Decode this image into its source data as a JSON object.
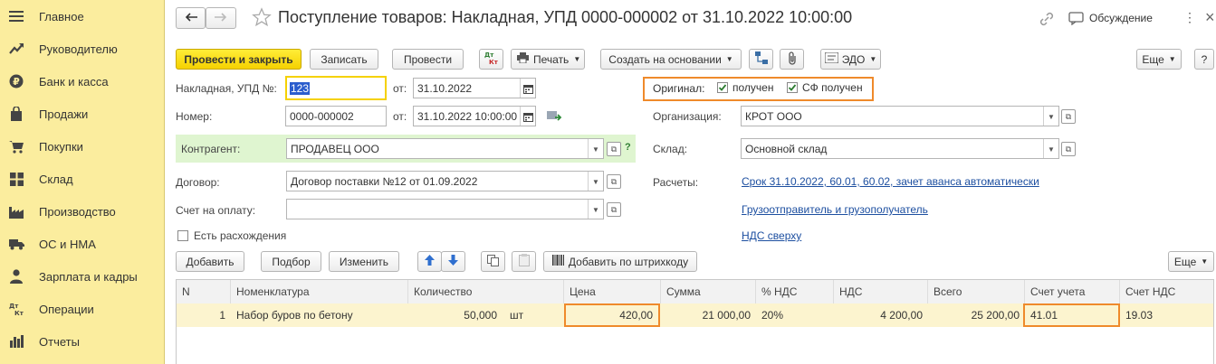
{
  "sidebar": {
    "items": [
      {
        "label": "Главное",
        "icon": "menu-icon"
      },
      {
        "label": "Руководителю",
        "icon": "trend-icon"
      },
      {
        "label": "Банк и касса",
        "icon": "ruble-icon"
      },
      {
        "label": "Продажи",
        "icon": "bag-icon"
      },
      {
        "label": "Покупки",
        "icon": "cart-icon"
      },
      {
        "label": "Склад",
        "icon": "grid-icon"
      },
      {
        "label": "Производство",
        "icon": "factory-icon"
      },
      {
        "label": "ОС и НМА",
        "icon": "truck-icon"
      },
      {
        "label": "Зарплата и кадры",
        "icon": "person-icon"
      },
      {
        "label": "Операции",
        "icon": "dt-kt-icon"
      },
      {
        "label": "Отчеты",
        "icon": "bar-chart-icon"
      }
    ]
  },
  "header": {
    "title": "Поступление товаров: Накладная, УПД 0000-000002 от 31.10.2022 10:00:00",
    "discussion": "Обсуждение"
  },
  "toolbar": {
    "post_close": "Провести и закрыть",
    "save": "Записать",
    "post": "Провести",
    "dtkt": "Дт\nКт",
    "print": "Печать",
    "create_based": "Создать на основании",
    "edo": "ЭДО",
    "more": "Еще"
  },
  "form": {
    "invoice_label": "Накладная, УПД №:",
    "invoice_value": "123",
    "from_label": "от:",
    "invoice_date": "31.10.2022",
    "number_label": "Номер:",
    "number_value": "0000-000002",
    "number_date": "31.10.2022 10:00:00",
    "contractor_label": "Контрагент:",
    "contractor_value": "ПРОДАВЕЦ ООО",
    "help": "?",
    "contract_label": "Договор:",
    "contract_value": "Договор поставки №12 от 01.09.2022",
    "payment_label": "Счет на оплату:",
    "payment_value": "",
    "discrepancy_label": "Есть расхождения",
    "original_label": "Оригинал:",
    "received_label": "получен",
    "sf_received_label": "СФ получен",
    "org_label": "Организация:",
    "org_value": "КРОТ ООО",
    "warehouse_label": "Склад:",
    "warehouse_value": "Основной склад",
    "settlements_label": "Расчеты:",
    "settlements_link": "Срок 31.10.2022, 60.01, 60.02, зачет аванса автоматически",
    "shipper_link": "Грузоотправитель и грузополучатель",
    "vat_link": "НДС сверху"
  },
  "table_toolbar": {
    "add": "Добавить",
    "pick": "Подбор",
    "change": "Изменить",
    "barcode": "Добавить по штрихкоду",
    "more": "Еще"
  },
  "table": {
    "columns": [
      "N",
      "Номенклатура",
      "Количество",
      "Цена",
      "Сумма",
      "% НДС",
      "НДС",
      "Всего",
      "Счет учета",
      "Счет НДС"
    ],
    "rows": [
      {
        "n": "1",
        "item": "Набор буров по бетону",
        "qty": "50,000",
        "unit": "шт",
        "price": "420,00",
        "sum": "21 000,00",
        "vat_rate": "20%",
        "vat": "4 200,00",
        "total": "25 200,00",
        "account": "41.01",
        "vat_account": "19.03"
      }
    ]
  },
  "colors": {
    "sidebar_bg": "#fbed9e",
    "primary_button": "#f5d100",
    "highlight": "#ef8a2b",
    "contractor_bg": "#dff5d0",
    "row_bg": "#fcf4cf",
    "link": "#1d4fa0"
  }
}
